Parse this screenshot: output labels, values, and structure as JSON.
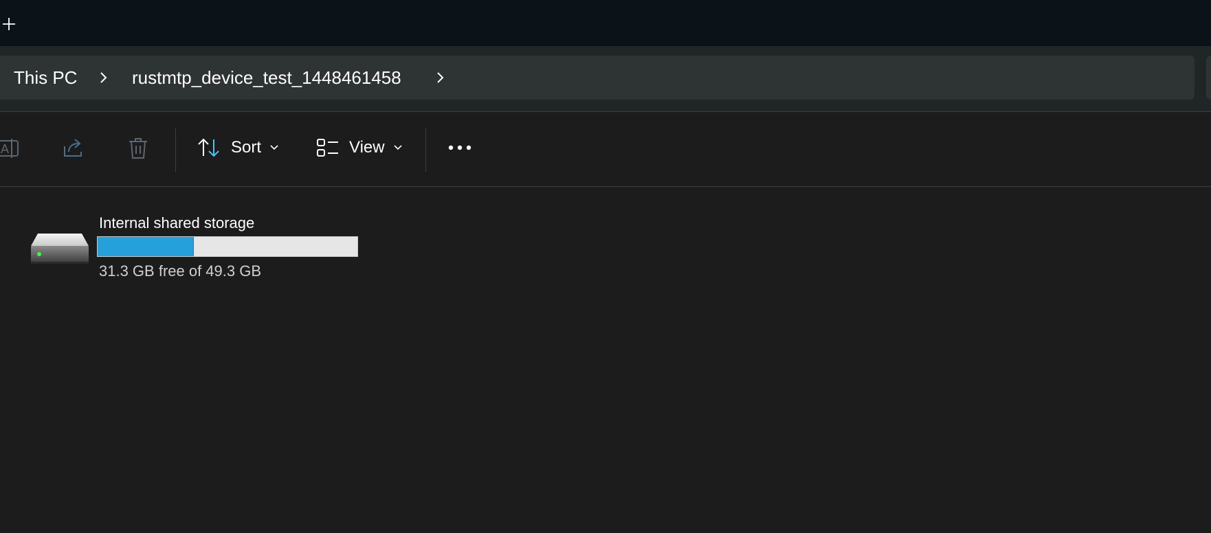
{
  "tabstrip": {
    "new_tab_icon": "plus-icon"
  },
  "address_bar": {
    "breadcrumbs": [
      {
        "label": "This PC"
      },
      {
        "label": "rustmtp_device_test_1448461458"
      }
    ],
    "chevron_icon": "chevron-right-icon"
  },
  "command_bar": {
    "rename_icon": "rename-icon",
    "share_icon": "share-icon",
    "delete_icon": "trash-icon",
    "sort_label": "Sort",
    "view_label": "View",
    "more_icon": "more-horizontal-icon"
  },
  "drive": {
    "name": "Internal shared storage",
    "free_text": "31.3 GB free of 49.3 GB",
    "used_fraction": 0.37,
    "icon": "hard-drive-icon",
    "colors": {
      "usage_fill": "#26a0da",
      "usage_track": "#e6e6e6"
    }
  }
}
